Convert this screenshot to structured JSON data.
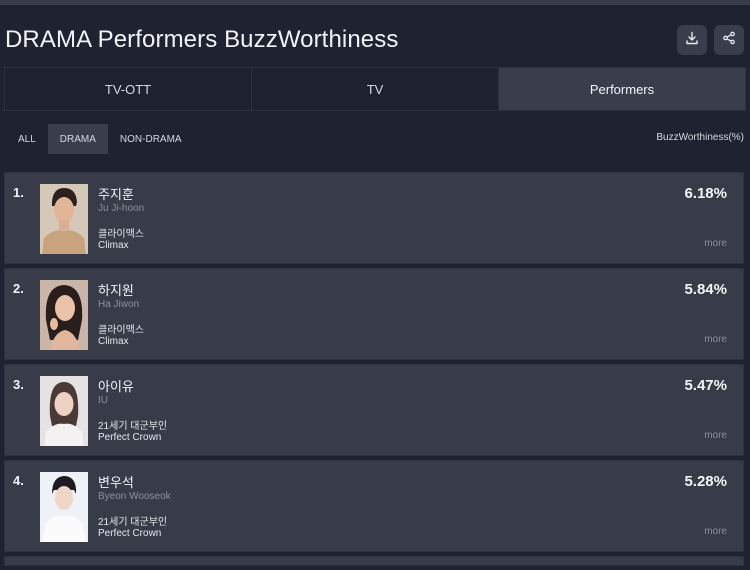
{
  "page": {
    "title": "DRAMA Performers BuzzWorthiness"
  },
  "actions": {
    "download_icon": "download-icon",
    "share_icon": "share-icon"
  },
  "tabs": [
    {
      "label": "TV-OTT",
      "active": false
    },
    {
      "label": "TV",
      "active": false
    },
    {
      "label": "Performers",
      "active": true
    }
  ],
  "filters": [
    {
      "label": "ALL",
      "active": false
    },
    {
      "label": "DRAMA",
      "active": true
    },
    {
      "label": "NON-DRAMA",
      "active": false
    }
  ],
  "metric_label": "BuzzWorthiness(%)",
  "more_label": "more",
  "rankings": [
    {
      "rank": "1.",
      "name_ko": "주지훈",
      "name_en": "Ju Ji-hoon",
      "show_ko": "클라이맥스",
      "show_en": "Climax",
      "value": "6.18%"
    },
    {
      "rank": "2.",
      "name_ko": "하지원",
      "name_en": "Ha Jiwon",
      "show_ko": "클라이맥스",
      "show_en": "Climax",
      "value": "5.84%"
    },
    {
      "rank": "3.",
      "name_ko": "아이유",
      "name_en": "IU",
      "show_ko": "21세기 대군부인",
      "show_en": "Perfect Crown",
      "value": "5.47%"
    },
    {
      "rank": "4.",
      "name_ko": "변우석",
      "name_en": "Byeon Wooseok",
      "show_ko": "21세기 대군부인",
      "show_en": "Perfect Crown",
      "value": "5.28%"
    }
  ],
  "colors": {
    "background": "#1f2230",
    "card": "#383c49",
    "active": "#3a3e4c",
    "muted_text": "#8d909c"
  }
}
